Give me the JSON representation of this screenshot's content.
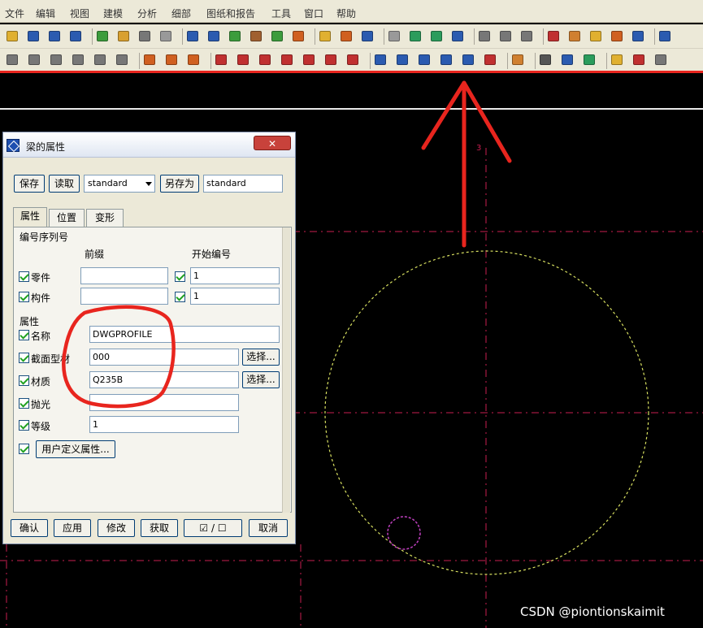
{
  "menu": [
    "文件",
    "编辑",
    "视图",
    "建模",
    "分析",
    "细部",
    "图纸和报告",
    "工具",
    "窗口",
    "帮助"
  ],
  "toolbar_icons": {
    "row1": [
      {
        "name": "new-icon",
        "color": "#e0b030"
      },
      {
        "name": "save-icon",
        "color": "#2b5bb0"
      },
      {
        "name": "undo-icon",
        "color": "#2b5bb0"
      },
      {
        "name": "redo-icon",
        "color": "#2b5bb0"
      },
      {
        "name": "open-model-icon",
        "color": "#3c9c3c"
      },
      {
        "name": "open-folder-icon",
        "color": "#d8a030"
      },
      {
        "name": "print-icon",
        "color": "#777777"
      },
      {
        "name": "select-filter-icon",
        "color": "#999999"
      },
      {
        "name": "view-rectangle-icon",
        "color": "#2b5bb0"
      },
      {
        "name": "view-window-icon",
        "color": "#2b5bb0"
      },
      {
        "name": "create-view-icon",
        "color": "#3c9c3c"
      },
      {
        "name": "cut-icon",
        "color": "#a06030"
      },
      {
        "name": "copy-view-icon",
        "color": "#3c9c3c"
      },
      {
        "name": "drawing-list-icon",
        "color": "#d06020"
      },
      {
        "name": "report-icon",
        "color": "#e0b030"
      },
      {
        "name": "drawing-icon",
        "color": "#d06020"
      },
      {
        "name": "document-icon",
        "color": "#2b5bb0"
      },
      {
        "name": "select-arrow-icon",
        "color": "#999999"
      },
      {
        "name": "model-icon",
        "color": "#2b9c5c"
      },
      {
        "name": "component-icon",
        "color": "#2b9c5c"
      },
      {
        "name": "help-icon",
        "color": "#2b5bb0"
      },
      {
        "name": "measure-icon",
        "color": "#777777"
      },
      {
        "name": "dimension-icon",
        "color": "#777777"
      },
      {
        "name": "move-icon",
        "color": "#777777"
      },
      {
        "name": "tool-icon",
        "color": "#c03030"
      },
      {
        "name": "settings-icon",
        "color": "#d08030"
      },
      {
        "name": "pencil-icon",
        "color": "#e0b030"
      },
      {
        "name": "group-icon",
        "color": "#d06020"
      },
      {
        "name": "table-icon",
        "color": "#2b5bb0"
      },
      {
        "name": "zoom-icon",
        "color": "#2b5bb0"
      }
    ],
    "row2": [
      {
        "name": "workplane-icon",
        "color": "#777777"
      },
      {
        "name": "column-icon",
        "color": "#777777"
      },
      {
        "name": "beam-icon",
        "color": "#777777"
      },
      {
        "name": "poly-beam-icon",
        "color": "#777777"
      },
      {
        "name": "plate-icon",
        "color": "#777777"
      },
      {
        "name": "panel-icon",
        "color": "#777777"
      },
      {
        "name": "bolt-icon",
        "color": "#d06020"
      },
      {
        "name": "weld-icon",
        "color": "#d06020"
      },
      {
        "name": "grid-icon",
        "color": "#d06020"
      },
      {
        "name": "line-icon",
        "color": "#c03030"
      },
      {
        "name": "point-icon",
        "color": "#c03030"
      },
      {
        "name": "point-along-icon",
        "color": "#c03030"
      },
      {
        "name": "point-parallel-icon",
        "color": "#c03030"
      },
      {
        "name": "point-intersect-icon",
        "color": "#c03030"
      },
      {
        "name": "point-arc-icon",
        "color": "#c03030"
      },
      {
        "name": "circle-point-icon",
        "color": "#c03030"
      },
      {
        "name": "steel-column-icon",
        "color": "#2b5bb0"
      },
      {
        "name": "steel-beam-icon",
        "color": "#2b5bb0"
      },
      {
        "name": "steel-polybeam-icon",
        "color": "#2b5bb0"
      },
      {
        "name": "curved-beam-icon",
        "color": "#2b5bb0"
      },
      {
        "name": "twin-profile-icon",
        "color": "#2b5bb0"
      },
      {
        "name": "chain-icon",
        "color": "#c03030"
      },
      {
        "name": "bolt-group-icon",
        "color": "#d08030"
      },
      {
        "name": "lock-icon",
        "color": "#555555"
      },
      {
        "name": "component-catalog-icon",
        "color": "#2b5bb0"
      },
      {
        "name": "custom-component-icon",
        "color": "#2b9c5c"
      },
      {
        "name": "detail-icon",
        "color": "#e0b030"
      },
      {
        "name": "ruler-icon",
        "color": "#c03030"
      },
      {
        "name": "wrench-icon",
        "color": "#777777"
      }
    ]
  },
  "dialog": {
    "title": "梁的属性",
    "close_label": "✕",
    "save_label": "保存",
    "load_label": "读取",
    "preset_value": "standard",
    "save_as_label": "另存为",
    "save_as_value": "standard",
    "tabs": [
      "属性",
      "位置",
      "变形"
    ],
    "numbering_header": "编号序列号",
    "col_prefix": "前缀",
    "col_start_number": "开始编号",
    "part_label": "零件",
    "part_prefix": "",
    "part_start": "1",
    "assembly_label": "构件",
    "assembly_prefix": "",
    "assembly_start": "1",
    "attributes_header": "属性",
    "name_label": "名称",
    "name_value": "DWGPROFILE",
    "profile_label": "截面型材",
    "profile_value": "000",
    "material_label": "材质",
    "material_value": "Q235B",
    "select_label": "选择...",
    "finish_label": "抛光",
    "finish_value": "",
    "class_label": "等级",
    "class_value": "1",
    "udf_label": "用户定义属性...",
    "bottom_buttons": {
      "ok": "确认",
      "apply": "应用",
      "modify": "修改",
      "get": "获取",
      "toggle": "☑ / ☐",
      "cancel": "取消"
    }
  },
  "canvas": {
    "grid_label": "3",
    "background": "#000000",
    "grid_color": "#c81e50",
    "circle_color": "#d8e060",
    "small_circle_color": "#c040c0"
  },
  "annotation_color": "#e8251e",
  "watermark": "CSDN @piontionskaimit"
}
